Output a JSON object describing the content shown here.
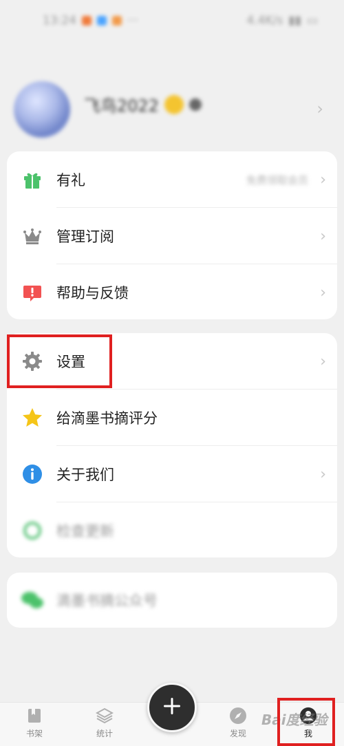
{
  "status_bar": {
    "time": "13:24",
    "network": "4.4K/s"
  },
  "profile": {
    "name": "飞鸟2022",
    "subtitle": ""
  },
  "menu_group_1": [
    {
      "label": "有礼",
      "right_text": "免费领取会员"
    },
    {
      "label": "管理订阅"
    },
    {
      "label": "帮助与反馈"
    }
  ],
  "menu_group_2": [
    {
      "label": "设置"
    },
    {
      "label": "给滴墨书摘评分"
    },
    {
      "label": "关于我们"
    },
    {
      "label": "检查更新"
    }
  ],
  "menu_group_3": [
    {
      "label": "滴墨书摘公众号"
    }
  ],
  "bottom_nav": [
    {
      "label": "书架"
    },
    {
      "label": "统计"
    },
    {
      "label": "发现"
    },
    {
      "label": "我"
    }
  ],
  "watermark": "Bai度经验",
  "colors": {
    "highlight": "#e02020",
    "gift": "#4cc26b",
    "help": "#f25252",
    "star": "#f5c518",
    "info": "#2f8fe6"
  }
}
